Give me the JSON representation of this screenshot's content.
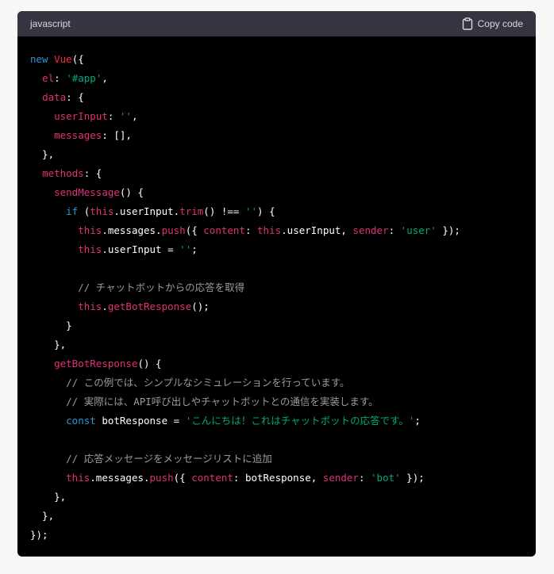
{
  "header": {
    "language": "javascript",
    "copy_label": "Copy code"
  },
  "code": {
    "lines": [
      [
        {
          "t": "new",
          "c": "kw"
        },
        {
          "t": " "
        },
        {
          "t": "Vue",
          "c": "cls"
        },
        {
          "t": "({"
        }
      ],
      [
        {
          "t": "  "
        },
        {
          "t": "el",
          "c": "prop"
        },
        {
          "t": ": "
        },
        {
          "t": "'#app'",
          "c": "str"
        },
        {
          "t": ","
        }
      ],
      [
        {
          "t": "  "
        },
        {
          "t": "data",
          "c": "prop"
        },
        {
          "t": ": {"
        }
      ],
      [
        {
          "t": "    "
        },
        {
          "t": "userInput",
          "c": "prop"
        },
        {
          "t": ": "
        },
        {
          "t": "''",
          "c": "str"
        },
        {
          "t": ","
        }
      ],
      [
        {
          "t": "    "
        },
        {
          "t": "messages",
          "c": "prop"
        },
        {
          "t": ": [],"
        }
      ],
      [
        {
          "t": "  },"
        }
      ],
      [
        {
          "t": "  "
        },
        {
          "t": "methods",
          "c": "prop"
        },
        {
          "t": ": {"
        }
      ],
      [
        {
          "t": "    "
        },
        {
          "t": "sendMessage",
          "c": "prop"
        },
        {
          "t": "() {"
        }
      ],
      [
        {
          "t": "      "
        },
        {
          "t": "if",
          "c": "kw"
        },
        {
          "t": " ("
        },
        {
          "t": "this",
          "c": "prop"
        },
        {
          "t": ".userInput."
        },
        {
          "t": "trim",
          "c": "prop"
        },
        {
          "t": "() !== "
        },
        {
          "t": "''",
          "c": "str"
        },
        {
          "t": ") {"
        }
      ],
      [
        {
          "t": "        "
        },
        {
          "t": "this",
          "c": "prop"
        },
        {
          "t": ".messages."
        },
        {
          "t": "push",
          "c": "prop"
        },
        {
          "t": "({ "
        },
        {
          "t": "content",
          "c": "prop"
        },
        {
          "t": ": "
        },
        {
          "t": "this",
          "c": "prop"
        },
        {
          "t": ".userInput, "
        },
        {
          "t": "sender",
          "c": "prop"
        },
        {
          "t": ": "
        },
        {
          "t": "'user'",
          "c": "str"
        },
        {
          "t": " });"
        }
      ],
      [
        {
          "t": "        "
        },
        {
          "t": "this",
          "c": "prop"
        },
        {
          "t": ".userInput = "
        },
        {
          "t": "''",
          "c": "str"
        },
        {
          "t": ";"
        }
      ],
      [
        {
          "t": ""
        }
      ],
      [
        {
          "t": "        "
        },
        {
          "t": "// チャットボットからの応答を取得",
          "c": "cm"
        }
      ],
      [
        {
          "t": "        "
        },
        {
          "t": "this",
          "c": "prop"
        },
        {
          "t": "."
        },
        {
          "t": "getBotResponse",
          "c": "prop"
        },
        {
          "t": "();"
        }
      ],
      [
        {
          "t": "      }"
        }
      ],
      [
        {
          "t": "    },"
        }
      ],
      [
        {
          "t": "    "
        },
        {
          "t": "getBotResponse",
          "c": "prop"
        },
        {
          "t": "() {"
        }
      ],
      [
        {
          "t": "      "
        },
        {
          "t": "// この例では、シンプルなシミュレーションを行っています。",
          "c": "cm"
        }
      ],
      [
        {
          "t": "      "
        },
        {
          "t": "// 実際には、API呼び出しやチャットボットとの通信を実装します。",
          "c": "cm"
        }
      ],
      [
        {
          "t": "      "
        },
        {
          "t": "const",
          "c": "kw"
        },
        {
          "t": " botResponse = "
        },
        {
          "t": "'こんにちは！これはチャットボットの応答です。'",
          "c": "str"
        },
        {
          "t": ";"
        }
      ],
      [
        {
          "t": ""
        }
      ],
      [
        {
          "t": "      "
        },
        {
          "t": "// 応答メッセージをメッセージリストに追加",
          "c": "cm"
        }
      ],
      [
        {
          "t": "      "
        },
        {
          "t": "this",
          "c": "prop"
        },
        {
          "t": ".messages."
        },
        {
          "t": "push",
          "c": "prop"
        },
        {
          "t": "({ "
        },
        {
          "t": "content",
          "c": "prop"
        },
        {
          "t": ": botResponse, "
        },
        {
          "t": "sender",
          "c": "prop"
        },
        {
          "t": ": "
        },
        {
          "t": "'bot'",
          "c": "str"
        },
        {
          "t": " });"
        }
      ],
      [
        {
          "t": "    },"
        }
      ],
      [
        {
          "t": "  },"
        }
      ],
      [
        {
          "t": "});"
        }
      ]
    ]
  },
  "colors": {
    "header_bg": "#343541",
    "code_bg": "#000000",
    "keyword": "#2e95d3",
    "property": "#df3079",
    "string": "#00a67d",
    "class": "#f22c3d",
    "comment": "#9b9b9b"
  },
  "icons": {
    "copy": "clipboard-icon"
  }
}
